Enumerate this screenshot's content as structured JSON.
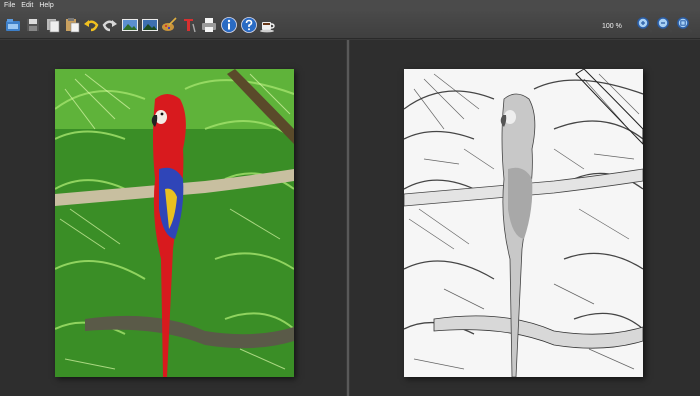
{
  "menu": {
    "items": [
      "File",
      "Edit",
      "Help"
    ]
  },
  "toolbar": {
    "zoom_label": "100 %",
    "buttons": [
      "open-icon",
      "save-icon",
      "copy-icon",
      "paste-icon",
      "undo-icon",
      "redo-icon",
      "original-image-icon",
      "result-image-icon",
      "settings-brush-icon",
      "text-tool-icon",
      "print-icon",
      "info-icon",
      "help-icon",
      "coffee-icon",
      "zoom-in-icon",
      "zoom-out-icon",
      "zoom-fit-icon"
    ]
  },
  "canvas": {
    "original_image": "scarlet-macaw-photo",
    "result_image": "pencil-sketch-result",
    "colors": {
      "background": "#2e2e2e",
      "parrot_red": "#d8181c",
      "parrot_blue": "#2f45b8",
      "foliage": "#3d9a28"
    }
  }
}
